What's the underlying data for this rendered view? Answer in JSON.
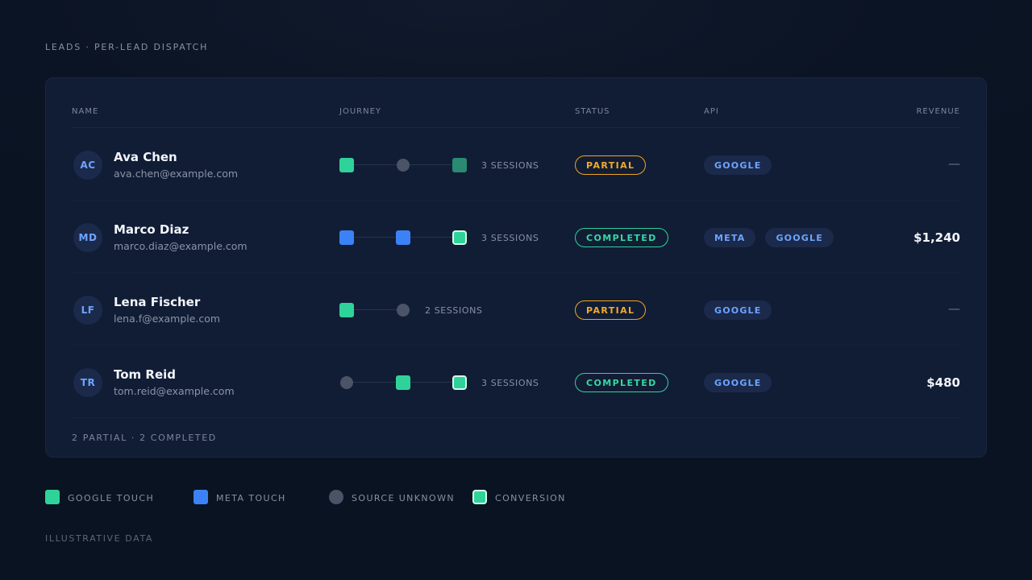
{
  "header": {
    "title": "LEADS · PER-LEAD DISPATCH"
  },
  "table": {
    "columns": {
      "name": "NAME",
      "journey": "JOURNEY",
      "status": "STATUS",
      "api": "API",
      "revenue": "REVENUE"
    },
    "rows": [
      {
        "initials": "AC",
        "name": "Ava Chen",
        "email": "ava.chen@example.com",
        "journey": [
          "google",
          "unknown",
          "conversion-pending"
        ],
        "sessions": "3 SESSIONS",
        "status": "PARTIAL",
        "status_type": "partial",
        "api": [
          "GOOGLE"
        ],
        "revenue": "—"
      },
      {
        "initials": "MD",
        "name": "Marco Diaz",
        "email": "marco.diaz@example.com",
        "journey": [
          "meta",
          "meta",
          "conversion"
        ],
        "sessions": "3 SESSIONS",
        "status": "COMPLETED",
        "status_type": "completed",
        "api": [
          "META",
          "GOOGLE"
        ],
        "revenue": "$1,240"
      },
      {
        "initials": "LF",
        "name": "Lena Fischer",
        "email": "lena.f@example.com",
        "journey": [
          "google",
          "unknown"
        ],
        "sessions": "2 SESSIONS",
        "status": "PARTIAL",
        "status_type": "partial",
        "api": [
          "GOOGLE"
        ],
        "revenue": "—"
      },
      {
        "initials": "TR",
        "name": "Tom Reid",
        "email": "tom.reid@example.com",
        "journey": [
          "unknown",
          "google",
          "conversion"
        ],
        "sessions": "3 SESSIONS",
        "status": "COMPLETED",
        "status_type": "completed",
        "api": [
          "GOOGLE"
        ],
        "revenue": "$480"
      }
    ],
    "summary": "2 PARTIAL · 2 COMPLETED"
  },
  "legend": [
    {
      "type": "google",
      "label": "GOOGLE TOUCH"
    },
    {
      "type": "meta",
      "label": "META TOUCH"
    },
    {
      "type": "unknown",
      "label": "SOURCE UNKNOWN"
    },
    {
      "type": "conversion",
      "label": "CONVERSION"
    }
  ],
  "footer": {
    "note": "ILLUSTRATIVE DATA"
  },
  "colors": {
    "google": "#2fd39a",
    "meta": "#3b82f6",
    "unknown": "#4b5467",
    "partial": "#f0a51e",
    "completed": "#2fd39a",
    "api_pill": "#6ea4ff"
  }
}
